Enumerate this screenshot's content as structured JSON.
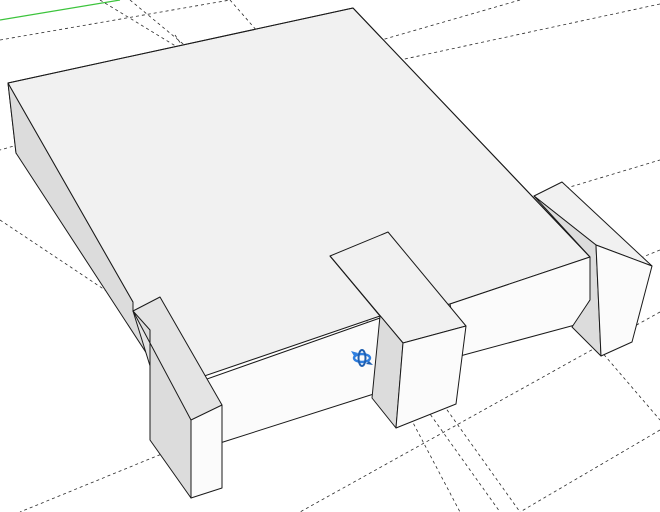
{
  "viewport": {
    "background": "#ffffff",
    "axis_color": "#3cc43c",
    "edge_color": "#1a1a1a",
    "face_colors": {
      "top": "#f1f1f1",
      "front": "#fbfbfb",
      "left": "#dcdcdc",
      "side": "#e4e4e4"
    }
  },
  "cursor": {
    "icon": "orbit-icon",
    "color": "#2f7fe0"
  }
}
